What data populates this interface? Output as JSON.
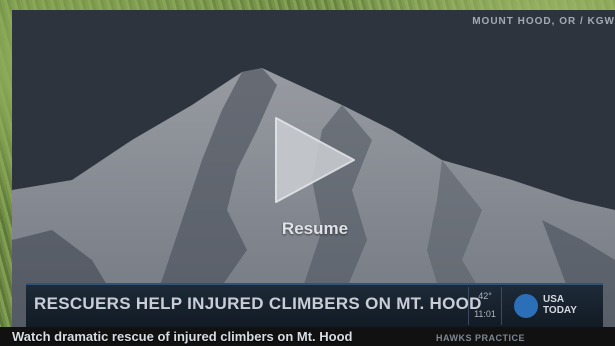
{
  "video": {
    "location_tag": "MOUNT HOOD, OR / KGW",
    "resume_label": "Resume"
  },
  "lower_third": {
    "headline": "RESCUERS HELP INJURED CLIMBERS ON MT. HOOD",
    "temperature": "42°",
    "time": "11:01",
    "brand_line1": "USA",
    "brand_line2": "TODAY"
  },
  "caption": {
    "title": "Watch dramatic rescue of injured climbers on Mt. Hood",
    "ticker": "HAWKS PRACTICE"
  },
  "colors": {
    "brand_blue": "#2b6fb8",
    "lower_third_bg": "#151f2a",
    "overlay": "#14161c"
  },
  "icons": {
    "play": "play-icon"
  }
}
